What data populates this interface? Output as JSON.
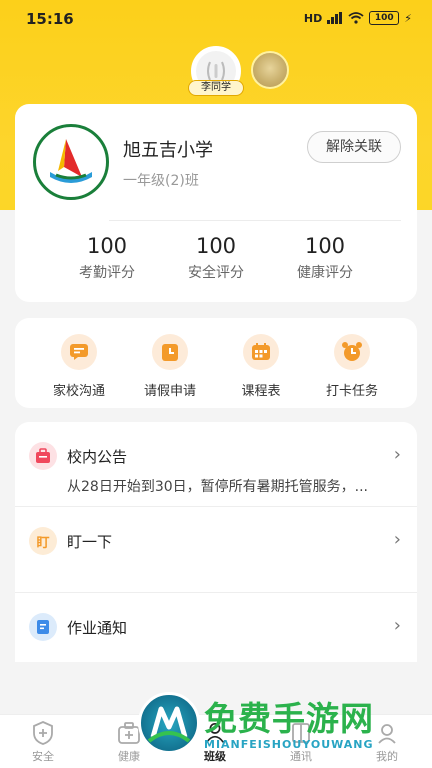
{
  "status_bar": {
    "time": "15:16",
    "signal_label": "HD",
    "battery": "100"
  },
  "student": {
    "name": "李同学"
  },
  "school": {
    "name": "旭五吉小学",
    "class": "一年级(2)班",
    "unlink_label": "解除关联"
  },
  "scores": [
    {
      "value": "100",
      "label": "考勤评分"
    },
    {
      "value": "100",
      "label": "安全评分"
    },
    {
      "value": "100",
      "label": "健康评分"
    }
  ],
  "quick_actions": [
    {
      "label": "家校沟通",
      "icon": "chat-icon"
    },
    {
      "label": "请假申请",
      "icon": "leave-icon"
    },
    {
      "label": "课程表",
      "icon": "calendar-icon"
    },
    {
      "label": "打卡任务",
      "icon": "alarm-clock-icon"
    }
  ],
  "list": {
    "notice": {
      "title": "校内公告",
      "subtitle": "从28日开始到30日，暂停所有暑期托管服务，...",
      "icon": "bag-icon"
    },
    "ding": {
      "title": "盯一下",
      "icon_text": "盯"
    },
    "homework": {
      "title": "作业通知",
      "icon": "notebook-icon"
    }
  },
  "tabbar": [
    {
      "label": "安全",
      "icon": "shield-icon"
    },
    {
      "label": "健康",
      "icon": "medical-kit-icon"
    },
    {
      "label": "班级",
      "icon": "class-icon"
    },
    {
      "label": "通讯",
      "icon": "book-icon"
    },
    {
      "label": "我的",
      "icon": "user-icon"
    }
  ],
  "watermark": {
    "title": "免费手游网",
    "subtitle": "MIANFEISHOUYOUWANG"
  },
  "colors": {
    "brand_yellow": "#fcd01a",
    "action_orange": "#f39a2a",
    "watermark_green": "#2bb24c"
  }
}
